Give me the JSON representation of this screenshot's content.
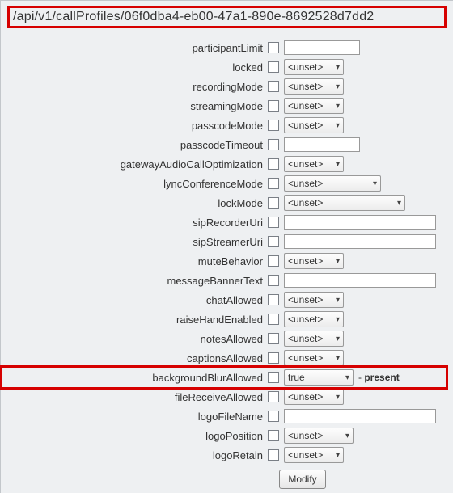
{
  "url": "/api/v1/callProfiles/06f0dba4-eb00-47a1-890e-8692528d7dd2",
  "unset_label": "<unset>",
  "true_label": "true",
  "present_suffix": "- present",
  "modify_label": "Modify",
  "fields": {
    "participantLimit": "participantLimit",
    "locked": "locked",
    "recordingMode": "recordingMode",
    "streamingMode": "streamingMode",
    "passcodeMode": "passcodeMode",
    "passcodeTimeout": "passcodeTimeout",
    "gatewayAudioCallOptimization": "gatewayAudioCallOptimization",
    "lyncConferenceMode": "lyncConferenceMode",
    "lockMode": "lockMode",
    "sipRecorderUri": "sipRecorderUri",
    "sipStreamerUri": "sipStreamerUri",
    "muteBehavior": "muteBehavior",
    "messageBannerText": "messageBannerText",
    "chatAllowed": "chatAllowed",
    "raiseHandEnabled": "raiseHandEnabled",
    "notesAllowed": "notesAllowed",
    "captionsAllowed": "captionsAllowed",
    "backgroundBlurAllowed": "backgroundBlurAllowed",
    "fileReceiveAllowed": "fileReceiveAllowed",
    "logoFileName": "logoFileName",
    "logoPosition": "logoPosition",
    "logoRetain": "logoRetain"
  }
}
